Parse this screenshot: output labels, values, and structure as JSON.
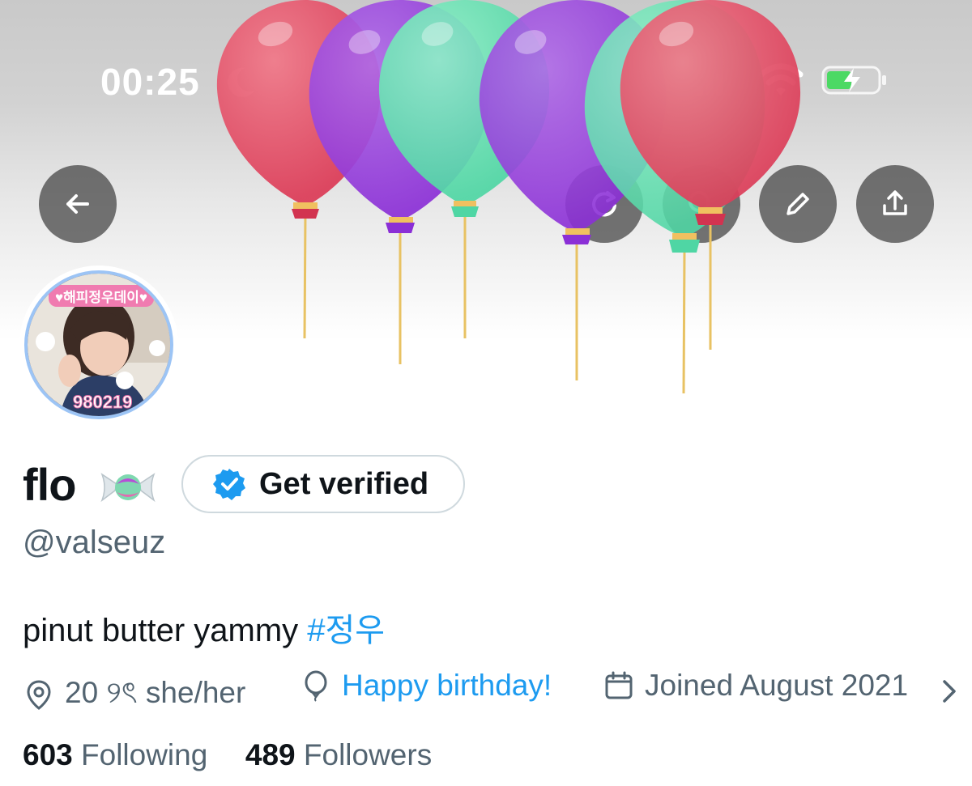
{
  "status_bar": {
    "time": "00:25"
  },
  "profile": {
    "display_name": "flo",
    "verify_label": "Get verified",
    "handle": "@valseuz",
    "bio_text": "pinut butter yammy",
    "bio_hashtag": "#정우",
    "avatar_top_text": "♥해피정우데이♥",
    "avatar_bottom_text": "980219",
    "location": "20 ୨ৎ she/her",
    "birthday_link": "Happy birthday!",
    "joined": "Joined August 2021",
    "following_count": "603",
    "following_label": "Following",
    "followers_count": "489",
    "followers_label": "Followers"
  },
  "colors": {
    "accent": "#1d9bf0",
    "secondary_text": "#536471",
    "primary_text": "#0f1419"
  }
}
